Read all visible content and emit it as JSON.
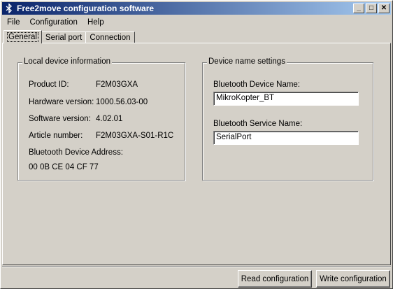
{
  "window": {
    "title": "Free2move configuration software"
  },
  "titlebar_buttons": {
    "minimize": "_",
    "maximize": "□",
    "close": "✕"
  },
  "menu": [
    "File",
    "Configuration",
    "Help"
  ],
  "tabs": [
    "General",
    "Serial port",
    "Connection"
  ],
  "local_info": {
    "legend": "Local device information",
    "product_id_label": "Product ID:",
    "product_id_value": "F2M03GXA",
    "hardware_label": "Hardware version:",
    "hardware_value": "1000.56.03-00",
    "software_label": "Software version:",
    "software_value": "4.02.01",
    "article_label": "Article number:",
    "article_value": "F2M03GXA-S01-R1C",
    "bt_address_label": "Bluetooth Device Address:",
    "bt_address_value": "00 0B CE 04 CF 77"
  },
  "name_settings": {
    "legend": "Device name settings",
    "device_name_label": "Bluetooth Device Name:",
    "device_name_value": "MikroKopter_BT",
    "service_name_label": "Bluetooth Service Name:",
    "service_name_value": "SerialPort"
  },
  "buttons": {
    "read": "Read configuration",
    "write": "Write configuration"
  },
  "colors": {
    "titlebar_start": "#0a246a",
    "titlebar_end": "#a6caf0",
    "face": "#d4d0c8"
  },
  "icons": {
    "app": "bluetooth-icon"
  }
}
